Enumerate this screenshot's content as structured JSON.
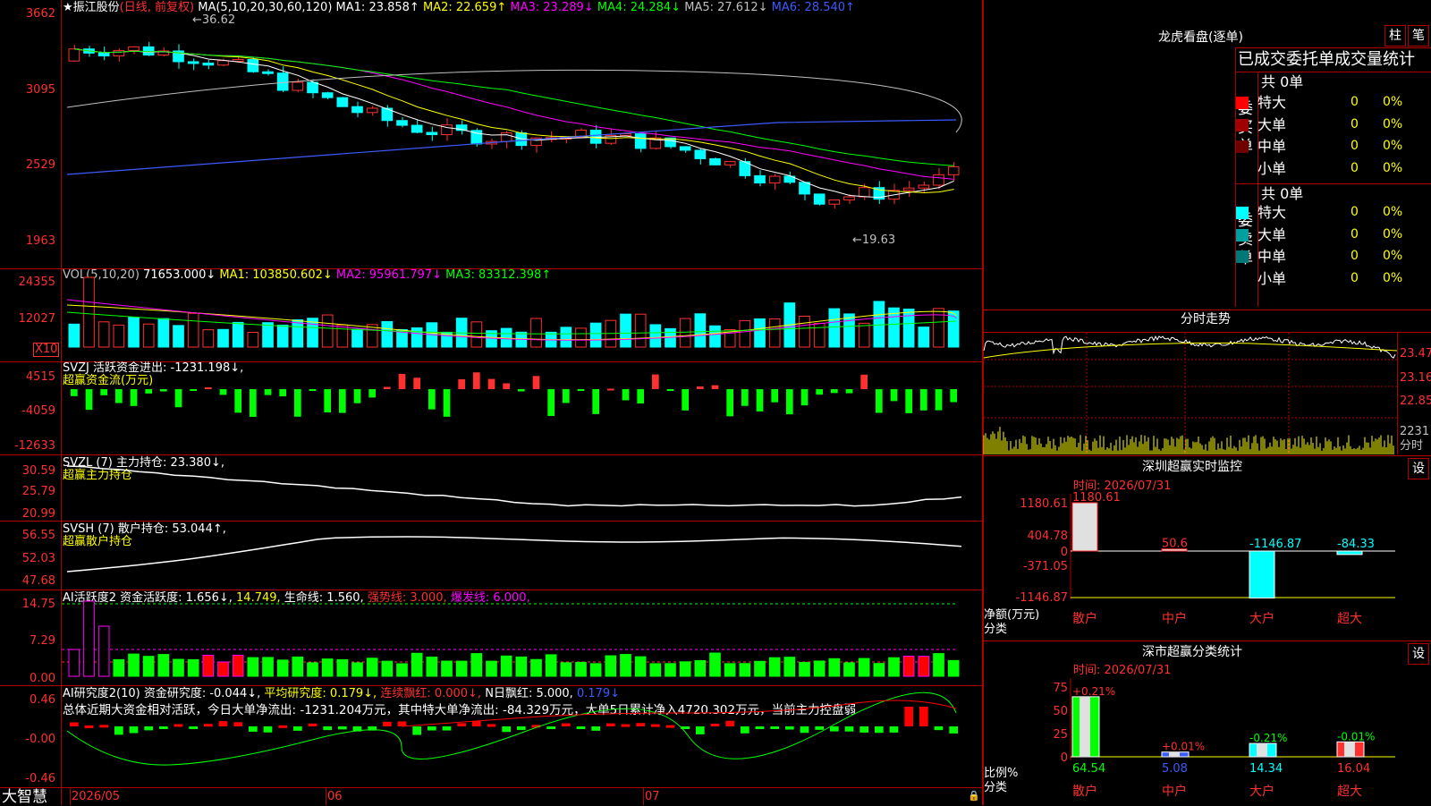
{
  "main": {
    "title_star": "★",
    "stock_name": "振江股份",
    "mode": "(日线, 前复权)",
    "ma_label": "MA(5,10,20,30,60,120)",
    "ma1": "MA1: 23.858↑",
    "ma2": "MA2: 22.659↑",
    "ma3": "MA3: 23.289↓",
    "ma4": "MA4: 24.284↓",
    "ma5": "MA5: 27.612↓",
    "ma6": "MA6: 28.540↑",
    "y_ticks": [
      "3662",
      "3095",
      "2529",
      "1963"
    ],
    "high_note": "←36.62",
    "low_note": "←19.63"
  },
  "vol": {
    "label": "VOL(5,10,20)",
    "value": "71653.000↓",
    "ma1": "MA1: 103850.602↓",
    "ma2": "MA2: 95961.797↓",
    "ma3": "MA3: 83312.398↑",
    "y_ticks": [
      "24355",
      "12027"
    ],
    "unit": "X10"
  },
  "svzj": {
    "label": "SVZJ  活跃资金进出: -1231.198↓,",
    "sub": "超赢资金流(万元)",
    "y_ticks": [
      "4515",
      "-4059",
      "-12633"
    ]
  },
  "svzl": {
    "label": "SVZL (7) 主力持仓: 23.380↓,",
    "sub": "超赢主力持仓",
    "y_ticks": [
      "30.59",
      "25.79",
      "20.99"
    ]
  },
  "svsh": {
    "label": "SVSH (7) 散户持仓: 53.044↑,",
    "sub": "超赢散户持仓",
    "y_ticks": [
      "56.55",
      "52.03",
      "47.68"
    ]
  },
  "ai1": {
    "label": "AI活跃度2 资金活跃度: 1.656↓,",
    "v2": "14.749,",
    "v3": "生命线: 1.560,",
    "v4": "强势线: 3.000,",
    "v5": "爆发线: 6.000,",
    "y_ticks": [
      "14.75",
      "7.29",
      "0.00"
    ]
  },
  "ai2": {
    "label": "AI研究度2(10) 资金研究度: -0.044↓,",
    "v2": "平均研究度: 0.179↓,",
    "v3": "连续飘红: 0.000↓,",
    "v4": "N日飘红: 5.000,",
    "v5": "0.179↓",
    "summary": "总体近期大资金相对活跃，今日大单净流出: -1231.204万元，其中特大单净流出: -84.329万元，大单5日累计净入4720.302万元，当前主力控盘弱",
    "y_ticks": [
      "0.46",
      "-0.00",
      "-0.46"
    ]
  },
  "bottom": {
    "brand": "大智慧",
    "dates": [
      "2026/05",
      "06",
      "07"
    ]
  },
  "right": {
    "lhb_title": "龙虎看盘(逐单)",
    "btn_zhu": "柱",
    "btn_bi": "笔",
    "stat_title": "已成交委托单成交量统计",
    "buy_label": "委买单",
    "sell_label": "委卖单",
    "buy_total": "共 0单",
    "sell_total": "共 0单",
    "buy_rows": [
      {
        "name": "特大",
        "v": "0",
        "p": "0%",
        "color": "#ff0000"
      },
      {
        "name": "大单",
        "v": "0",
        "p": "0%",
        "color": "#a00000"
      },
      {
        "name": "中单",
        "v": "0",
        "p": "0%",
        "color": "#700000"
      },
      {
        "name": "小单",
        "v": "0",
        "p": "0%",
        "color": "#000000"
      }
    ],
    "sell_rows": [
      {
        "name": "特大",
        "v": "0",
        "p": "0%",
        "color": "#00ffff"
      },
      {
        "name": "大单",
        "v": "0",
        "p": "0%",
        "color": "#00a0a0"
      },
      {
        "name": "中单",
        "v": "0",
        "p": "0%",
        "color": "#007878"
      },
      {
        "name": "小单",
        "v": "0",
        "p": "0%",
        "color": "#000000"
      }
    ],
    "fs_title": "分时走势",
    "fs_ticks": [
      "23.47",
      "23.16",
      "22.85",
      "2231",
      "分时"
    ],
    "sz_title": "深圳超赢实时监控",
    "sz_btn": "设",
    "sz_time": "时间: 2026/07/31",
    "sz_ticks": [
      "1180.61",
      "404.78",
      "0",
      "-371.05",
      "-1146.87"
    ],
    "sz_vals": [
      "1180.61",
      "50.6",
      "-1146.87",
      "-84.33"
    ],
    "sz_ylabel": "净额(万元)",
    "sz_xlabel": "分类",
    "sz_cats": [
      "散户",
      "中户",
      "大户",
      "超大"
    ],
    "cls_title": "深市超赢分类统计",
    "cls_btn": "设",
    "cls_time": "时间: 2026/07/31",
    "cls_ticks": [
      "75",
      "50",
      "25",
      "0"
    ],
    "cls_top": [
      "+0.21%",
      "+0.01%",
      "-0.21%",
      "-0.01%"
    ],
    "cls_vals": [
      "64.54",
      "5.08",
      "14.34",
      "16.04"
    ],
    "cls_ylabel": "比例%",
    "cls_xlabel": "分类",
    "cls_cats": [
      "散户",
      "中户",
      "大户",
      "超大"
    ]
  }
}
